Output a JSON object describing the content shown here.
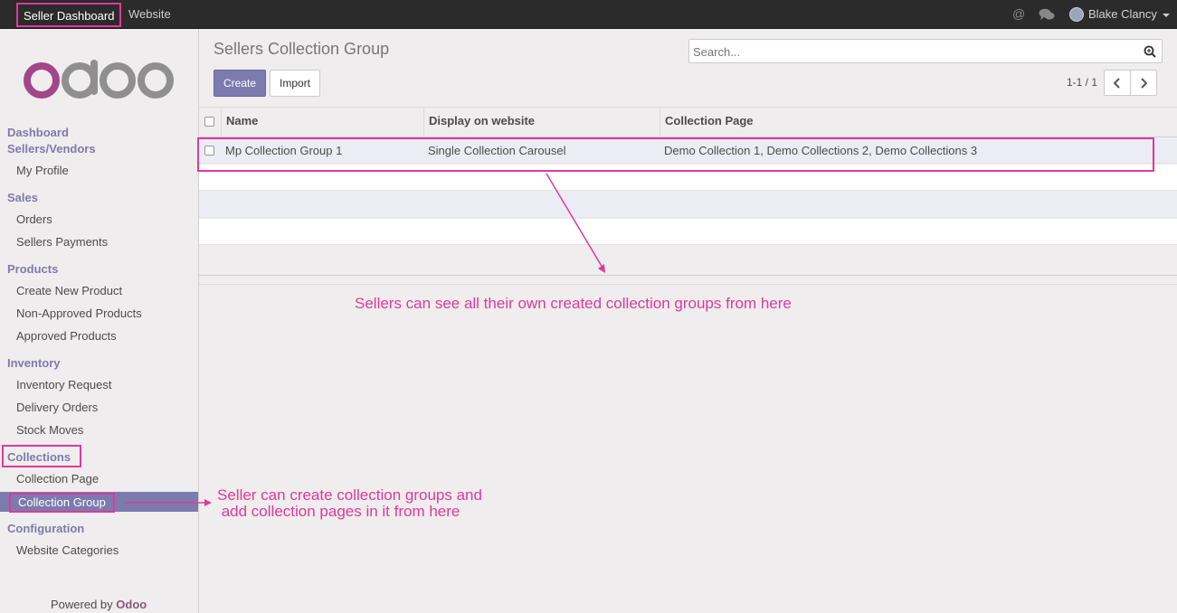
{
  "topbar": {
    "app_menu": "Seller Dashboard",
    "website_menu": "Website",
    "user_name": "Blake Clancy",
    "at_icon_glyph": "@",
    "icons": [
      "at-icon",
      "chat-icon",
      "avatar-icon",
      "caret-down-icon"
    ]
  },
  "sidebar": {
    "sections": [
      {
        "label": "Dashboard"
      },
      {
        "label": "Sellers/Vendors"
      },
      {
        "label": "Sales"
      },
      {
        "label": "Products"
      },
      {
        "label": "Inventory"
      },
      {
        "label": "Collections"
      },
      {
        "label": "Configuration"
      }
    ],
    "items": {
      "my_profile": "My Profile",
      "orders": "Orders",
      "sellers_payments": "Sellers Payments",
      "create_new_product": "Create New Product",
      "non_approved_products": "Non-Approved Products",
      "approved_products": "Approved Products",
      "inventory_request": "Inventory Request",
      "delivery_orders": "Delivery Orders",
      "stock_moves": "Stock Moves",
      "collection_page": "Collection Page",
      "collection_group": "Collection Group",
      "website_categories": "Website Categories"
    },
    "powered_by": "Powered by",
    "powered_brand": "Odoo",
    "logo_text": "odoo"
  },
  "main": {
    "title": "Sellers Collection Group",
    "search_placeholder": "Search...",
    "create_label": "Create",
    "import_label": "Import",
    "pager": "1-1 / 1",
    "columns": [
      "Name",
      "Display on website",
      "Collection Page"
    ],
    "rows": [
      {
        "name": "Mp Collection Group 1",
        "display": "Single Collection Carousel",
        "pages": "Demo Collection 1, Demo Collections 2, Demo Collections 3"
      }
    ]
  },
  "annotations": {
    "list_note": "Sellers can see all their own created collection groups from here",
    "menu_note_line1": "Seller can create collection groups and",
    "menu_note_line2": " add collection pages in it from here"
  },
  "colors": {
    "accent": "#7c7bad",
    "annotation": "#e0399a",
    "brand": "#875a7b",
    "topbar": "#2b2b2b"
  }
}
